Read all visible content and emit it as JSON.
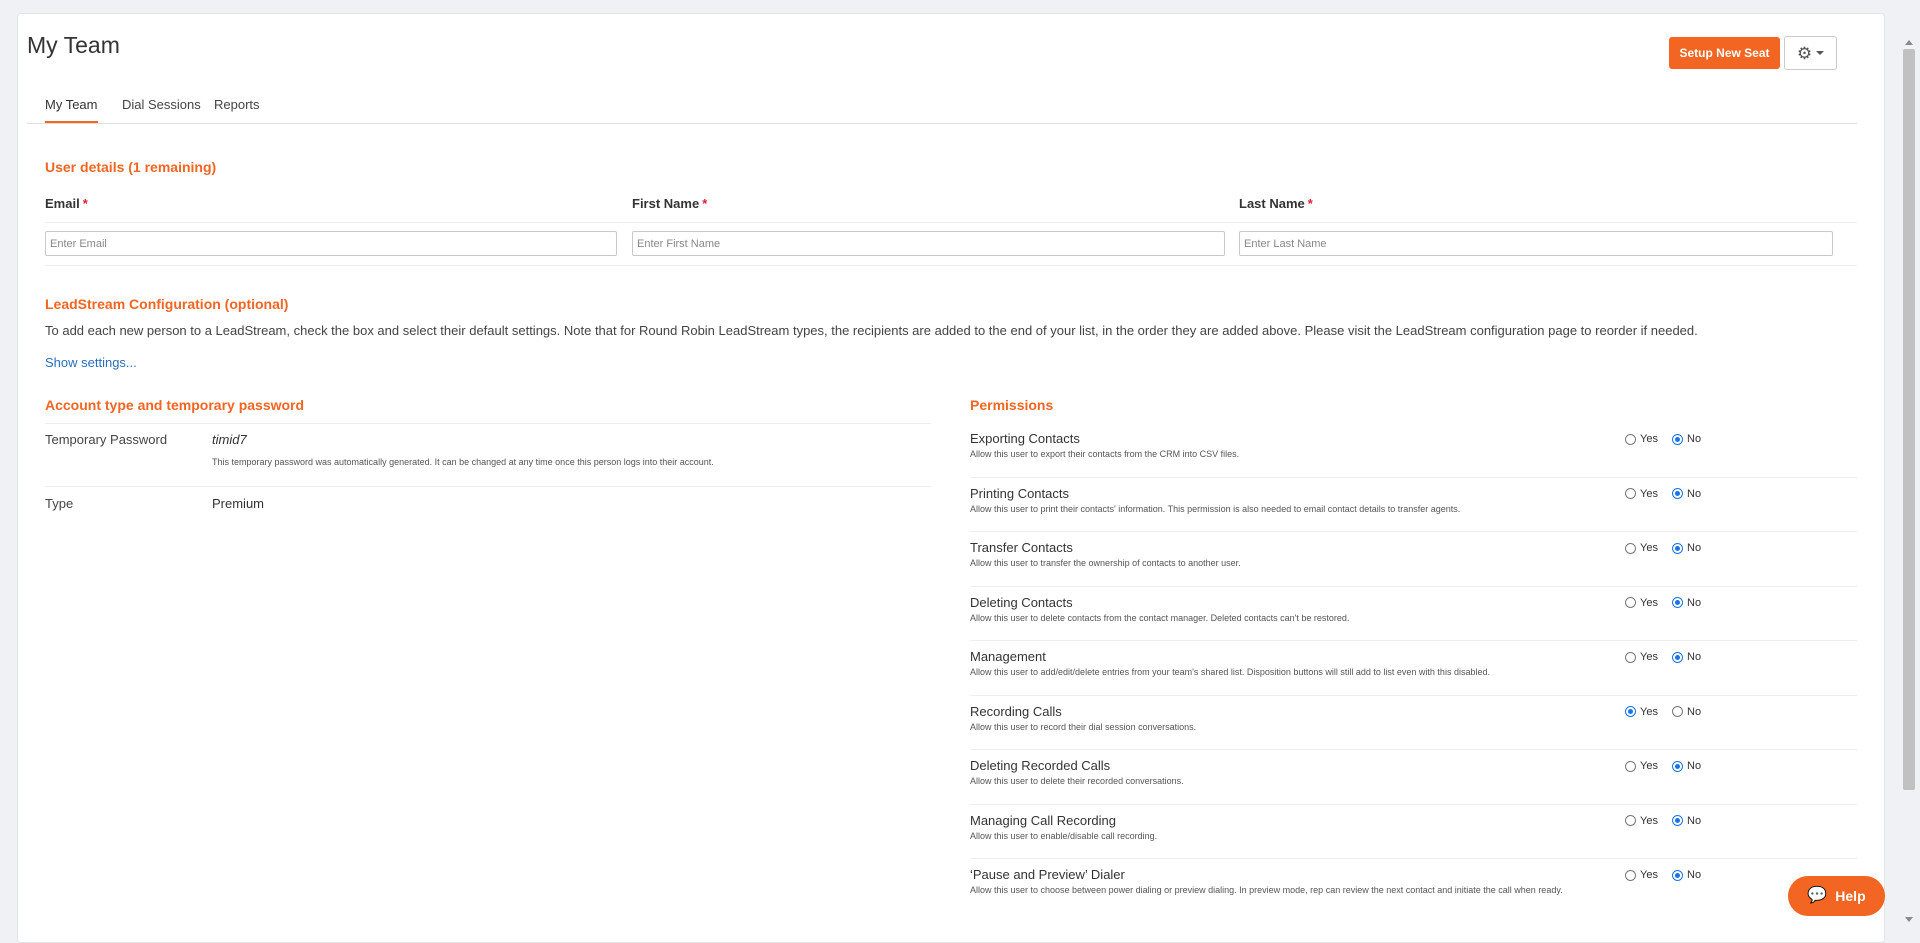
{
  "page": {
    "title": "My Team"
  },
  "header": {
    "setup_button": "Setup New Seat",
    "gear_glyph": "⚙"
  },
  "tabs": [
    {
      "label": "My Team",
      "active": true
    },
    {
      "label": "Dial Sessions",
      "active": false
    },
    {
      "label": "Reports",
      "active": false
    }
  ],
  "user_details": {
    "title": "User details (1 remaining)",
    "email": {
      "label": "Email",
      "required": "*",
      "placeholder": "Enter Email",
      "value": ""
    },
    "first_name": {
      "label": "First Name",
      "required": "*",
      "placeholder": "Enter First Name",
      "value": ""
    },
    "last_name": {
      "label": "Last Name",
      "required": "*",
      "placeholder": "Enter Last Name",
      "value": ""
    }
  },
  "leadstream": {
    "title": "LeadStream Configuration (optional)",
    "description": "To add each new person to a LeadStream, check the box and select their default settings. Note that for Round Robin LeadStream types, the recipients are added to the end of your list, in the order they are added above. Please visit the LeadStream configuration page to reorder if needed.",
    "show_settings": "Show settings..."
  },
  "account": {
    "title": "Account type and temporary password",
    "temp_password_label": "Temporary Password",
    "temp_password_value": "timid7",
    "temp_password_note": "This temporary password was automatically generated. It can be changed at any time once this person logs into their account.",
    "type_label": "Type",
    "type_value": "Premium"
  },
  "permissions": {
    "title": "Permissions",
    "yes_label": "Yes",
    "no_label": "No",
    "items": [
      {
        "name": "Exporting Contacts",
        "description": "Allow this user to export their contacts from the CRM into CSV files.",
        "selected": "No"
      },
      {
        "name": "Printing Contacts",
        "description": "Allow this user to print their contacts' information. This permission is also needed to email contact details to transfer agents.",
        "selected": "No"
      },
      {
        "name": "Transfer Contacts",
        "description": "Allow this user to transfer the ownership of contacts to another user.",
        "selected": "No"
      },
      {
        "name": "Deleting Contacts",
        "description": "Allow this user to delete contacts from the contact manager. Deleted contacts can't be restored.",
        "selected": "No"
      },
      {
        "name": "Management",
        "description": "Allow this user to add/edit/delete entries from your team's shared list. Disposition buttons will still add to list even with this disabled.",
        "selected": "No"
      },
      {
        "name": "Recording Calls",
        "description": "Allow this user to record their dial session conversations.",
        "selected": "Yes"
      },
      {
        "name": "Deleting Recorded Calls",
        "description": "Allow this user to delete their recorded conversations.",
        "selected": "No"
      },
      {
        "name": "Managing Call Recording",
        "description": "Allow this user to enable/disable call recording.",
        "selected": "No"
      },
      {
        "name": "‘Pause and Preview’ Dialer",
        "description": "Allow this user to choose between power dialing or preview dialing. In preview mode, rep can review the next contact and initiate the call when ready.",
        "selected": "No"
      }
    ]
  },
  "help": {
    "label": "Help",
    "icon_glyph": "💬"
  },
  "colors": {
    "accent": "#f26522",
    "link": "#2a6ebb",
    "radio_checked": "#1a73e8",
    "required": "#e0212d"
  }
}
